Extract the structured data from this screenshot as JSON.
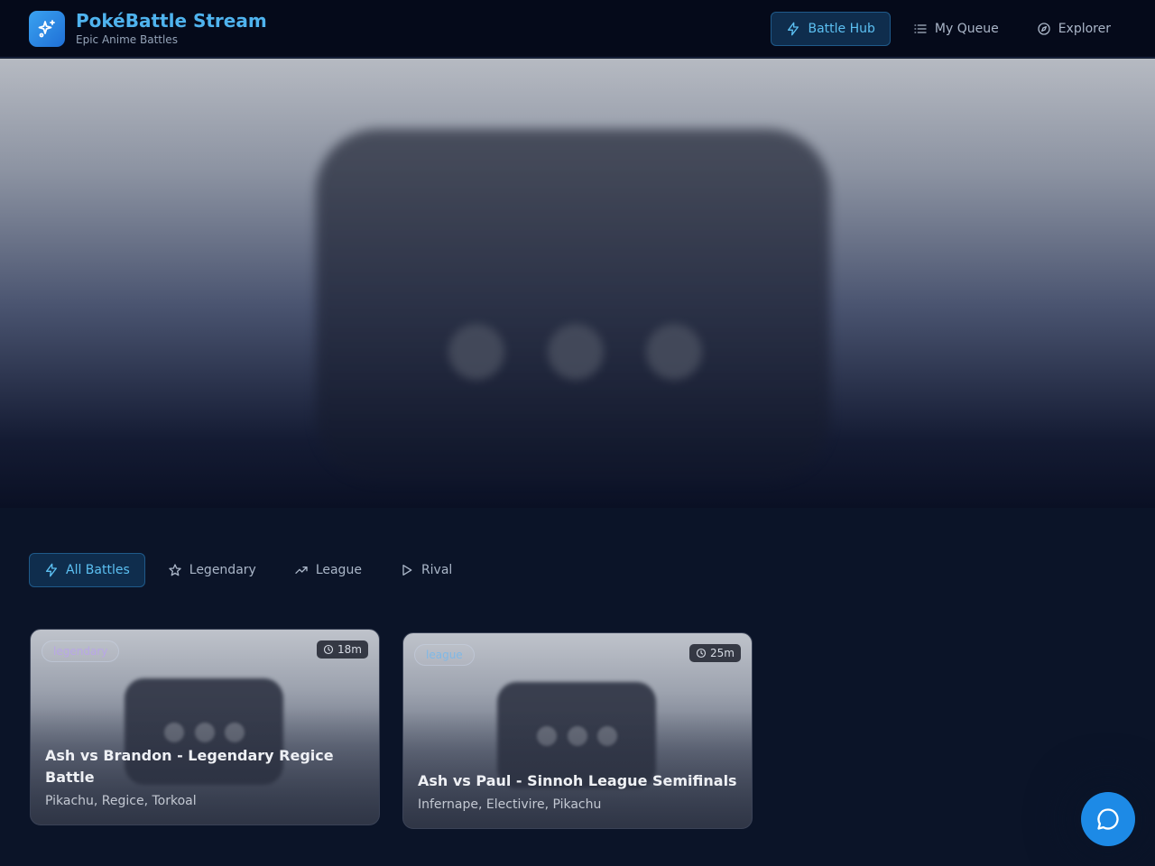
{
  "header": {
    "title": "PokéBattle Stream",
    "subtitle": "Epic Anime Battles",
    "nav": [
      {
        "label": "Battle Hub",
        "icon": "lightning-icon",
        "active": true
      },
      {
        "label": "My Queue",
        "icon": "list-icon",
        "active": false
      },
      {
        "label": "Explorer",
        "icon": "compass-icon",
        "active": false
      }
    ]
  },
  "filters": [
    {
      "label": "All Battles",
      "icon": "lightning-icon",
      "active": true
    },
    {
      "label": "Legendary",
      "icon": "star-icon",
      "active": false
    },
    {
      "label": "League",
      "icon": "trending-up-icon",
      "active": false
    },
    {
      "label": "Rival",
      "icon": "play-icon",
      "active": false
    }
  ],
  "cards": [
    {
      "tag": "legendary",
      "duration": "18m",
      "title": "Ash vs Brandon - Legendary Regice Battle",
      "cast": "Pikachu, Regice, Torkoal"
    },
    {
      "tag": "league",
      "duration": "25m",
      "title": "Ash vs Paul - Sinnoh League Semifinals",
      "cast": "Infernape, Electivire, Pikachu"
    }
  ],
  "colors": {
    "accent": "#4fb3ee",
    "fab": "#1d8ae6",
    "background": "#0b1428"
  }
}
